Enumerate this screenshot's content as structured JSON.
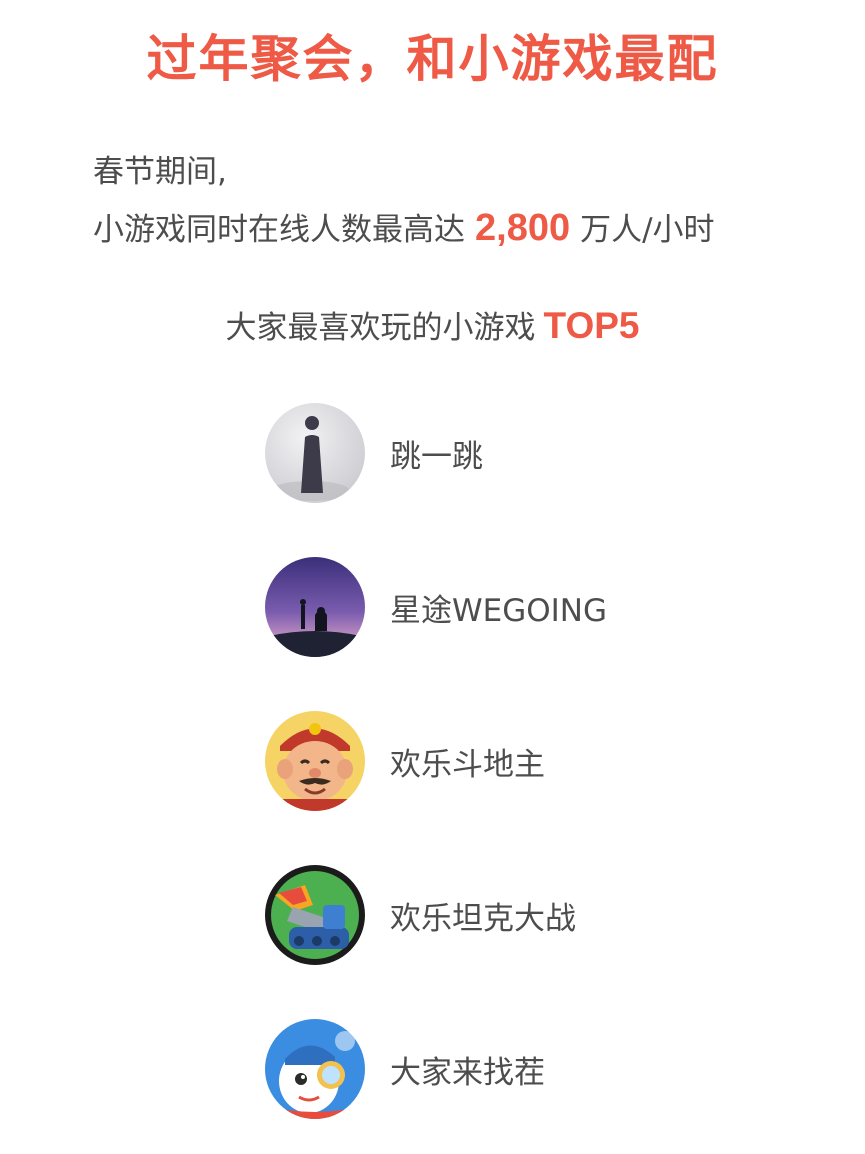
{
  "title": "过年聚会，和小游戏最配",
  "intro": {
    "line1": "春节期间,",
    "line2_prefix": "小游戏同时在线人数最高达",
    "line2_number": "2,800",
    "line2_suffix": "万人/小时"
  },
  "subtitle": {
    "text": "大家最喜欢玩的小游戏",
    "highlight": "TOP5"
  },
  "games": [
    {
      "name": "跳一跳",
      "icon": "jump-jump-icon"
    },
    {
      "name": "星途WEGOING",
      "icon": "wegoing-icon"
    },
    {
      "name": "欢乐斗地主",
      "icon": "doudizhu-icon"
    },
    {
      "name": "欢乐坦克大战",
      "icon": "tank-battle-icon"
    },
    {
      "name": "大家来找茬",
      "icon": "find-difference-icon"
    }
  ],
  "colors": {
    "accent": "#ee5a45",
    "text": "#4d4d4d",
    "background": "#ffffff"
  }
}
